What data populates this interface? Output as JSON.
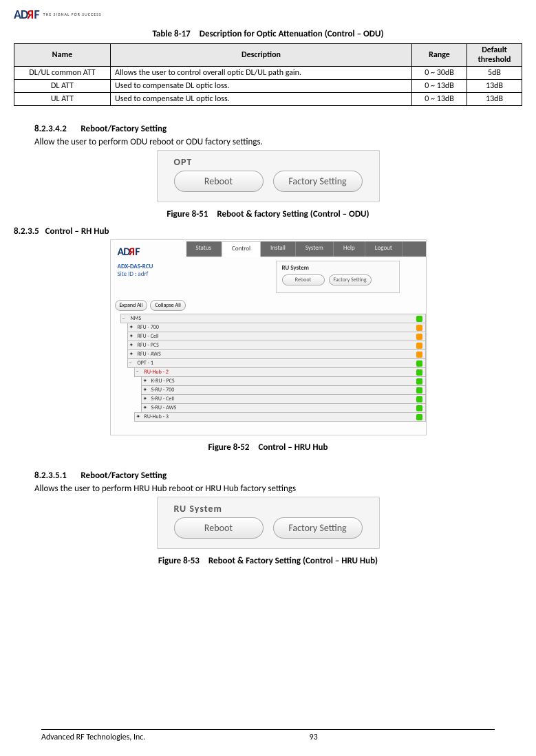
{
  "logo": {
    "brand_a": "AD",
    "brand_r": "R",
    "brand_f": "F",
    "tagline": "THE SIGNAL FOR SUCCESS"
  },
  "table_caption": "Table 8-17 Description for Optic Attenuation (Control – ODU)",
  "table_headers": {
    "name": "Name",
    "desc": "Description",
    "range": "Range",
    "def": "Default threshold"
  },
  "table_rows": [
    {
      "name": "DL/UL common ATT",
      "desc": "Allows the user to control overall optic DL/UL path gain.",
      "range": "0 ~ 30dB",
      "def": "5dB"
    },
    {
      "name": "DL ATT",
      "desc": "Used to compensate DL optic loss.",
      "range": "0 ~ 13dB",
      "def": "13dB"
    },
    {
      "name": "UL ATT",
      "desc": "Used to compensate UL optic loss.",
      "range": "0 ~ 13dB",
      "def": "13dB"
    }
  ],
  "sec_82342_num": "8.2.3.4.2",
  "sec_82342_title": "Reboot/Factory Setting",
  "sec_82342_body": "Allow the user to perform ODU reboot or ODU factory settings.",
  "opt_panel": {
    "title": "OPT",
    "btn_reboot": "Reboot",
    "btn_factory": "Factory Setting"
  },
  "fig_851": "Figure 8-51 Reboot & factory Setting (Control – ODU)",
  "sec_8235_num": "8.2.3.5",
  "sec_8235_title": "Control – RH Hub",
  "hru": {
    "product": "ADX-DAS-RCU",
    "site": "Site ID : adrf",
    "tabs": {
      "status": "Status",
      "control": "Control",
      "install": "Install",
      "system": "System",
      "help": "Help",
      "logout": "Logout"
    },
    "panel_title": "RU System",
    "btn_reboot": "Reboot",
    "btn_factory": "Factory Setting",
    "expand": "Expand All",
    "collapse": "Collapse All",
    "tree": {
      "nms": "NMS",
      "rfu700": "RFU - 700",
      "rfucell": "RFU - Cell",
      "rfupcs": "RFU - PCS",
      "rfuaws": "RFU - AWS",
      "opt1": "OPT - 1",
      "ruhub2": "RU-Hub - 2",
      "kru": "K-RU - PCS",
      "sru700": "S-RU - 700",
      "srucell": "S-RU - Cell",
      "sruaws": "S-RU - AWS",
      "ruhub3": "RU-Hub - 3"
    }
  },
  "fig_852": "Figure 8-52 Control – HRU Hub",
  "sec_82351_num": "8.2.3.5.1",
  "sec_82351_title": "Reboot/Factory Setting",
  "sec_82351_body": "Allows the user to perform HRU Hub reboot or HRU Hub factory settings",
  "ru_panel": {
    "title": "RU System",
    "btn_reboot": "Reboot",
    "btn_factory": "Factory Setting"
  },
  "fig_853": "Figure 8-53 Reboot & Factory Setting (Control – HRU Hub)",
  "footer": {
    "company": "Advanced RF Technologies, Inc.",
    "page": "93"
  }
}
